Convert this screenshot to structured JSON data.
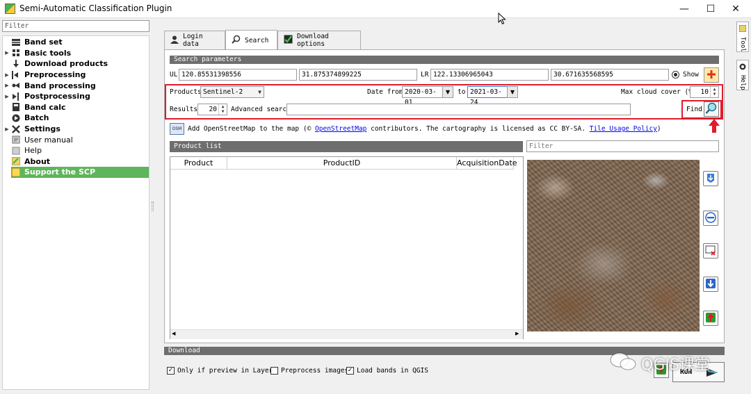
{
  "window": {
    "title": "Semi-Automatic Classification Plugin",
    "minimize": "—",
    "maximize": "☐",
    "close": "✕"
  },
  "sidebar": {
    "filter_placeholder": "Filter",
    "items": [
      {
        "label": "Band set",
        "arrow": ""
      },
      {
        "label": "Basic tools",
        "arrow": "▶"
      },
      {
        "label": "Download products",
        "arrow": ""
      },
      {
        "label": "Preprocessing",
        "arrow": "▶"
      },
      {
        "label": "Band processing",
        "arrow": "▶"
      },
      {
        "label": "Postprocessing",
        "arrow": "▶"
      },
      {
        "label": "Band calc",
        "arrow": ""
      },
      {
        "label": "Batch",
        "arrow": ""
      },
      {
        "label": "Settings",
        "arrow": "▶"
      },
      {
        "label": "User manual",
        "arrow": ""
      },
      {
        "label": "Help",
        "arrow": ""
      },
      {
        "label": "About",
        "arrow": ""
      },
      {
        "label": "Support the SCP",
        "arrow": ""
      }
    ]
  },
  "tabs": [
    {
      "label": "Login data"
    },
    {
      "label": "Search"
    },
    {
      "label": "Download options"
    }
  ],
  "search": {
    "section_title": "Search parameters",
    "ul_label": "UL",
    "ul_x": "120.85531398556",
    "ul_y": "31.875374899225",
    "lr_label": "LR",
    "lr_x": "122.13306965043",
    "lr_y": "30.671635568595",
    "show_label": "Show",
    "products_label": "Products",
    "product_value": "Sentinel-2",
    "date_from_label": "Date from",
    "date_from": "2020-03-01",
    "to_label": "to",
    "date_to": "2021-03-24",
    "max_cloud_label": "Max cloud cover (%)",
    "max_cloud": "10",
    "results_label": "Results",
    "results": "20",
    "advanced_label": "Advanced search",
    "advanced_value": "",
    "find_label": "Find"
  },
  "osm": {
    "icon_text": "OSM",
    "prefix": "Add OpenStreetMap to the map (© ",
    "link1": "OpenStreetMap",
    "middle": " contributors. The cartography is licensed as CC BY-SA. ",
    "link2": "Tile Usage Policy",
    "suffix": ")"
  },
  "product_list": {
    "title": "Product list",
    "filter_placeholder": "Filter",
    "columns": [
      "Product",
      "ProductID",
      "AcquisitionDate"
    ]
  },
  "download": {
    "section_title": "Download",
    "only_preview_label": "Only if preview in Layers",
    "only_preview_checked": "✓",
    "preprocess_label": "Preprocess images",
    "preprocess_checked": "",
    "load_bands_label": "Load bands in QGIS",
    "load_bands_checked": "✓",
    "run_label": "RUN"
  },
  "side_tabs": [
    {
      "label": "Tool"
    },
    {
      "label": "Help"
    }
  ],
  "watermark": "QGIS课堂",
  "colors": {
    "accent_green": "#5fb55b",
    "highlight_red": "#e01b2b",
    "section_gray": "#6e6e6e"
  }
}
